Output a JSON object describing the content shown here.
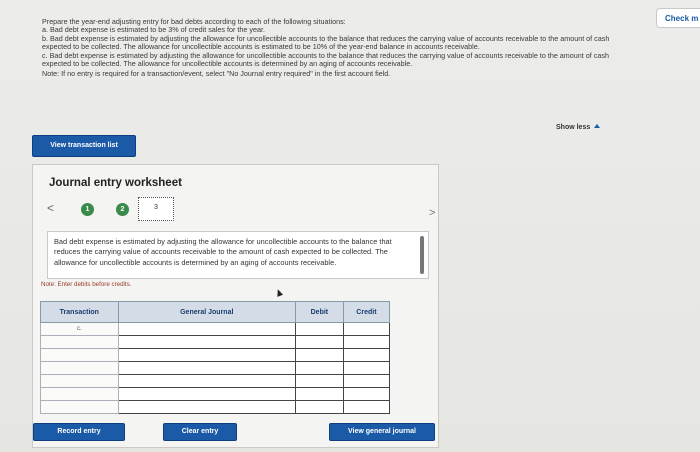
{
  "header": {
    "check_label": "Check m"
  },
  "instructions": {
    "intro": "Prepare the year-end adjusting entry for bad debts according to each of the following situations:",
    "a": "a. Bad debt expense is estimated to be 3% of credit sales for the year.",
    "b": "b. Bad debt expense is estimated by adjusting the allowance for uncollectible accounts to the balance that reduces the carrying value of accounts receivable to the amount of cash expected to be collected. The allowance for uncollectible accounts is estimated to be 10% of the year-end balance in accounts receivable.",
    "c": "c. Bad debt expense is estimated by adjusting the allowance for uncollectible accounts to the balance that reduces the carrying value of accounts receivable to the amount of cash expected to be collected. The allowance for uncollectible accounts is determined by an aging of accounts receivable.",
    "note": "Note: If no entry is required for a transaction/event, select \"No Journal entry required\" in the first account field."
  },
  "show_less_label": "Show less",
  "view_transaction_label": "View transaction list",
  "worksheet": {
    "title": "Journal entry worksheet",
    "nav_prev": "<",
    "nav_next": ">",
    "steps": [
      "1",
      "2",
      "3"
    ],
    "description": "Bad debt expense is estimated by adjusting the allowance for uncollectible accounts to the balance that reduces the carrying value of accounts receivable to the amount of cash expected to be collected. The allowance for uncollectible accounts is determined by an aging of accounts receivable.",
    "note": "Note: Enter debits before credits.",
    "table": {
      "headers": [
        "Transaction",
        "General Journal",
        "Debit",
        "Credit"
      ],
      "first_row_transaction": "c."
    },
    "buttons": {
      "record": "Record entry",
      "clear": "Clear entry",
      "view_general": "View general journal"
    }
  }
}
